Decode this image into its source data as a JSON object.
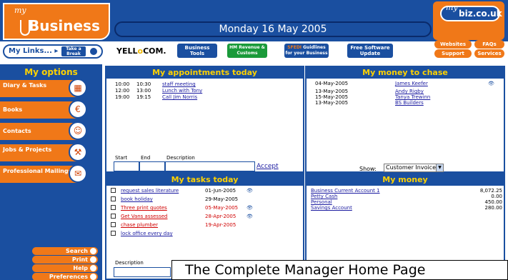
{
  "header": {
    "logo_my": "my",
    "logo_text": "Business",
    "date": "Monday 16 May 2005",
    "bizlogo_my": "my",
    "bizlogo_domain": "biz.co.uk"
  },
  "toolbar": {
    "mylinks_label": "My Links...",
    "take_a_break": "Take a Break",
    "yell_a": "YELL",
    "yell_o": "o",
    "yell_b": "COM.",
    "business_tools": "Business Tools",
    "hm_revenue": "HM Revenue & Customs",
    "sfedi_s": "SFEDI",
    "sfedi_text": "Guidlines for your Business",
    "free_software": "Free Software Update",
    "right_links": [
      "Websites",
      "FAQs",
      "Support",
      "Services"
    ]
  },
  "sidebar": {
    "title": "My options",
    "items": [
      {
        "label": "Diary & Tasks",
        "icon": "calendar-icon"
      },
      {
        "label": "Books",
        "icon": "coin-icon"
      },
      {
        "label": "Contacts",
        "icon": "people-icon"
      },
      {
        "label": "Jobs & Projects",
        "icon": "worker-icon"
      },
      {
        "label": "Professional Mailings",
        "icon": "envelope-icon"
      }
    ],
    "bottom": [
      "Search",
      "Print",
      "Help",
      "Preferences"
    ]
  },
  "appointments": {
    "title": "My appointments today",
    "rows": [
      {
        "start": "10:00",
        "end": "10:30",
        "desc": "staff meeting"
      },
      {
        "start": "12:00",
        "end": "13:00",
        "desc": "Lunch with Tony"
      },
      {
        "start": "19:00",
        "end": "19:15",
        "desc": "Call Jim Norris"
      }
    ],
    "col_start": "Start",
    "col_end": "End",
    "col_desc": "Description",
    "accept": "Accept"
  },
  "money_chase": {
    "title": "My money to chase",
    "rows": [
      {
        "date": "04-May-2005",
        "name": "James Keefer"
      },
      {
        "date": "13-May-2005",
        "name": "Andy Rigby"
      },
      {
        "date": "15-May-2005",
        "name": "Tanya Trewinn"
      },
      {
        "date": "13-May-2005",
        "name": "BS Builders"
      }
    ],
    "show_label": "Show:",
    "show_value": "Customer Invoices"
  },
  "tasks": {
    "title": "My tasks today",
    "rows": [
      {
        "desc": "request sales literature",
        "date": "01-Jun-2005",
        "overdue": false
      },
      {
        "desc": "book holiday",
        "date": "29-May-2005",
        "overdue": false
      },
      {
        "desc": "Three print quotes",
        "date": "05-May-2005",
        "overdue": true
      },
      {
        "desc": "Get Vans assessed",
        "date": "28-Apr-2005",
        "overdue": true
      },
      {
        "desc": "chase plumber",
        "date": "19-Apr-2005",
        "overdue": true
      },
      {
        "desc": "lock office every day",
        "date": "",
        "overdue": false
      }
    ],
    "desc_label": "Description"
  },
  "money": {
    "title": "My money",
    "rows": [
      {
        "account": "Business Current Account 1",
        "amount": "8,072.25"
      },
      {
        "account": "Petty Cash",
        "amount": "0.00"
      },
      {
        "account": "Personal",
        "amount": "450.00"
      },
      {
        "account": "Savings Account",
        "amount": "280.00"
      }
    ]
  },
  "caption": "The Complete Manager Home Page"
}
